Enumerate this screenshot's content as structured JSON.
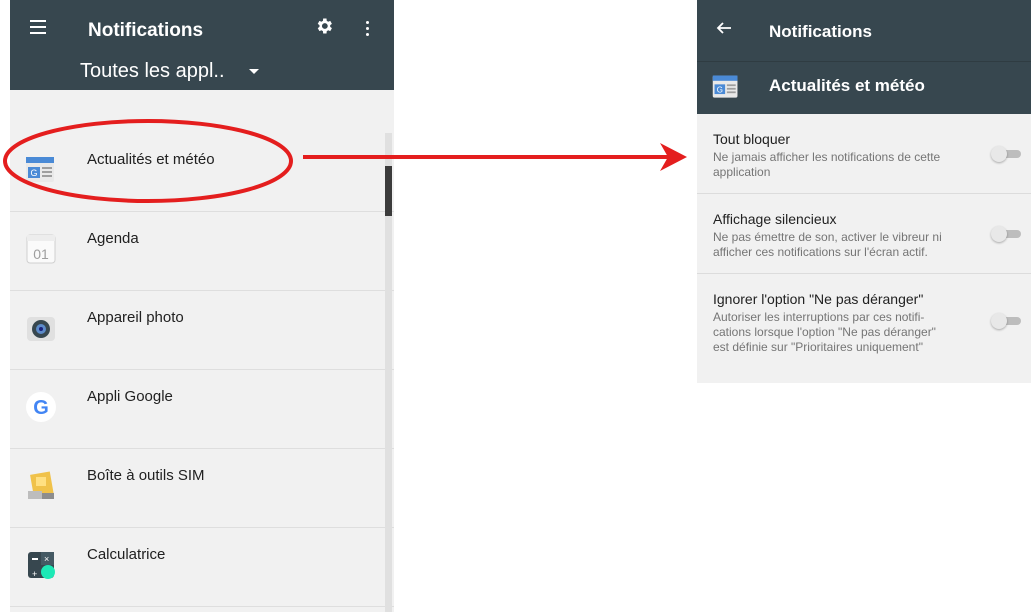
{
  "left": {
    "appbar": {
      "title": "Notifications",
      "filter_label": "Toutes les appl.."
    },
    "apps": [
      {
        "name": "Actualités et météo",
        "icon": "news-weather-icon"
      },
      {
        "name": "Agenda",
        "icon": "calendar-icon",
        "icon_text": "01"
      },
      {
        "name": "Appareil photo",
        "icon": "camera-icon"
      },
      {
        "name": "Appli Google",
        "icon": "google-icon",
        "icon_text": "G"
      },
      {
        "name": "Boîte à outils SIM",
        "icon": "sim-toolkit-icon"
      },
      {
        "name": "Calculatrice",
        "icon": "calculator-icon"
      }
    ]
  },
  "right": {
    "toolbar": {
      "title": "Notifications"
    },
    "app_header": {
      "name": "Actualités et météo"
    },
    "settings": [
      {
        "title": "Tout bloquer",
        "desc": "Ne jamais afficher les notifications de cette application",
        "enabled": false
      },
      {
        "title": "Affichage silencieux",
        "desc": "Ne pas émettre de son, activer le vibreur ni afficher ces notifications sur l'écran actif.",
        "enabled": false
      },
      {
        "title": "Ignorer l'option \"Ne pas déranger\"",
        "desc": "Autoriser les interruptions par ces notifi-cations lorsque l'option \"Ne pas déranger\" est définie sur \"Prioritaires uniquement\"",
        "enabled": false
      }
    ]
  },
  "colors": {
    "appbar": "#37474f",
    "list_bg": "#f1f1f1",
    "annotation_red": "#e41e1e"
  }
}
